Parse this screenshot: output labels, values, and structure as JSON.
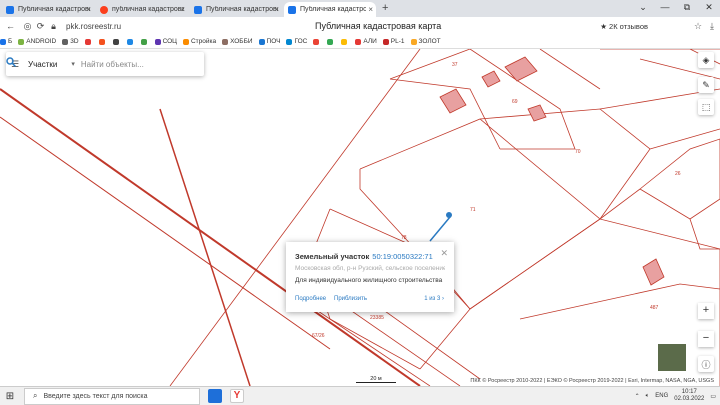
{
  "tabs": [
    {
      "label": "Публичная кадастровая",
      "color": "#1a73e8"
    },
    {
      "label": "публичная кадастровая",
      "color": "#fc3f1d"
    },
    {
      "label": "Публичная кадастровая",
      "color": "#1a73e8"
    },
    {
      "label": "Публичная кадастровая",
      "color": "#1a73e8"
    }
  ],
  "window": {
    "minimize": "—",
    "maximize": "⧉",
    "close": "✕",
    "restore": "⌄"
  },
  "address": {
    "url": "pkk.rosreestr.ru",
    "page_title": "Публичная кадастровая карта",
    "reviews": "★ 2К отзывов"
  },
  "bookmarks": [
    {
      "label": "Б",
      "color": "#1a73e8"
    },
    {
      "label": "ANDROID",
      "color": "#7cb342"
    },
    {
      "label": "3D",
      "color": "#616161"
    },
    {
      "label": "",
      "color": "#e53935"
    },
    {
      "label": "",
      "color": "#f4511e"
    },
    {
      "label": "",
      "color": "#424242"
    },
    {
      "label": "",
      "color": "#1e88e5"
    },
    {
      "label": "",
      "color": "#43a047"
    },
    {
      "label": "СОЦ",
      "color": "#5e35b1"
    },
    {
      "label": "Стройка",
      "color": "#fb8c00"
    },
    {
      "label": "ХОББИ",
      "color": "#8d6e63"
    },
    {
      "label": "ПОЧ",
      "color": "#1976d2"
    },
    {
      "label": "ГОС",
      "color": "#0288d1"
    },
    {
      "label": "",
      "color": "#ea4335"
    },
    {
      "label": "",
      "color": "#34a853"
    },
    {
      "label": "",
      "color": "#fbbc05"
    },
    {
      "label": "АЛИ",
      "color": "#e53935"
    },
    {
      "label": "PL-1",
      "color": "#c62828"
    },
    {
      "label": "ЗОЛОТ",
      "color": "#f9a825"
    }
  ],
  "search": {
    "mode": "Участки",
    "placeholder": "Найти объекты..."
  },
  "parcels": {
    "labels": [
      "37",
      "69",
      "70",
      "26",
      "71",
      "78",
      "487",
      "23385",
      "67/26"
    ]
  },
  "popup": {
    "title": "Земельный участок",
    "number": "50:19:0050322:71",
    "address": "Московская обл, р-н Рузский, сельское поселение К...",
    "use": "Для индивидуального жилищного строительства",
    "more": "Подробнее",
    "zoom": "Приблизить",
    "pager": "1 из 3"
  },
  "map_controls": {
    "zoom_in": "+",
    "zoom_out": "−"
  },
  "scale": "20 м",
  "copyright": {
    "left": "ПКК © Росреестр 2010-2022 | ЕЭКО © Росреестр 2019-2022 | Esri, Intermap, NASA, NGA, USGS"
  },
  "taskbar": {
    "search_placeholder": "Введите здесь текст для поиска",
    "lang": "ENG",
    "time": "10:17",
    "date": "02.03.2022"
  }
}
